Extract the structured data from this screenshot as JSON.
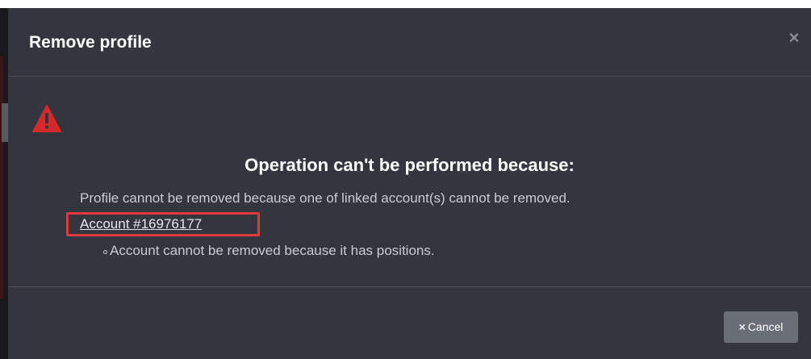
{
  "modal": {
    "title": "Remove profile",
    "close_glyph": "×",
    "warning_icon": "warning-triangle-icon",
    "heading": "Operation can't be performed because:",
    "message": "Profile cannot be removed because one of linked account(s) cannot be removed.",
    "account_link": "Account #16976177",
    "reasons": [
      "Account cannot be removed because it has positions."
    ],
    "cancel_icon": "×",
    "cancel_label": "Cancel"
  },
  "colors": {
    "modal_bg": "#33363e",
    "warning_red": "#d42a2a",
    "highlight_red": "#e0393d",
    "button_bg": "#6a6e77"
  }
}
